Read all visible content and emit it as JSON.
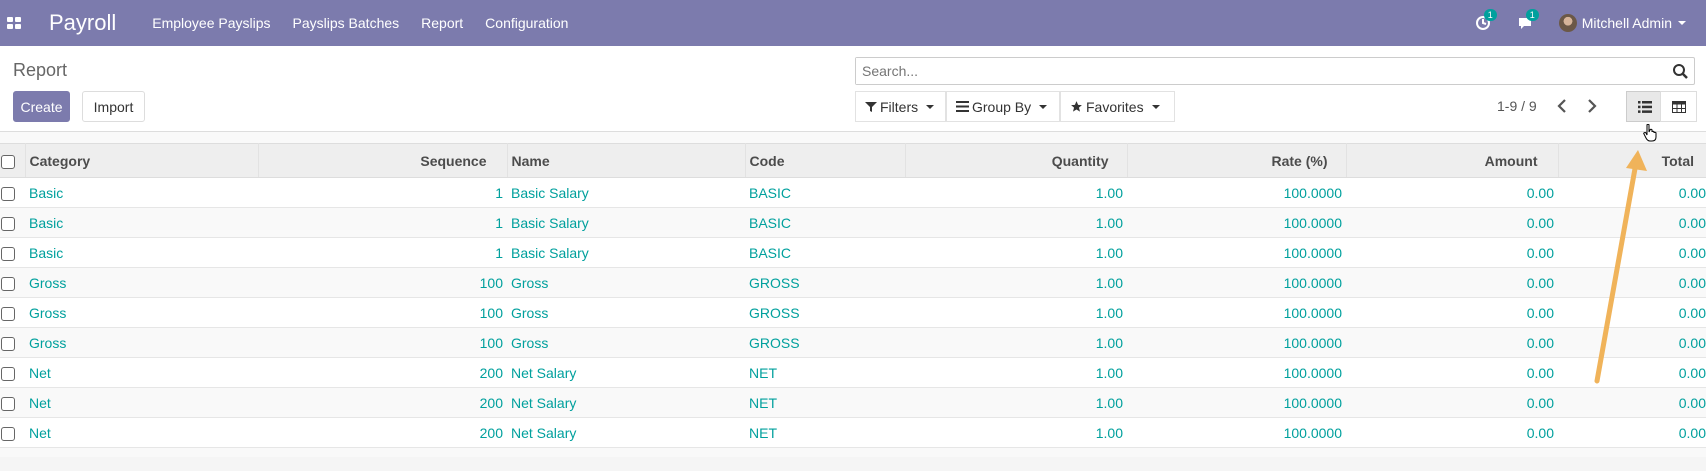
{
  "navbar": {
    "app_name": "Payroll",
    "menu": [
      "Employee Payslips",
      "Payslips Batches",
      "Report",
      "Configuration"
    ],
    "activity_badge": "1",
    "messages_badge": "1",
    "user_name": "Mitchell Admin",
    "bg_color": "#7c7bad"
  },
  "control_panel": {
    "breadcrumb": "Report",
    "create_label": "Create",
    "import_label": "Import",
    "search_placeholder": "Search...",
    "filters_label": "Filters",
    "groupby_label": "Group By",
    "favorites_label": "Favorites",
    "pager": "1-9 / 9"
  },
  "table": {
    "headers": [
      "Category",
      "Sequence",
      "Name",
      "Code",
      "Quantity",
      "Rate (%)",
      "Amount",
      "Total"
    ],
    "rows": [
      [
        "Basic",
        "1",
        "Basic Salary",
        "BASIC",
        "1.00",
        "100.0000",
        "0.00",
        "0.00"
      ],
      [
        "Basic",
        "1",
        "Basic Salary",
        "BASIC",
        "1.00",
        "100.0000",
        "0.00",
        "0.00"
      ],
      [
        "Basic",
        "1",
        "Basic Salary",
        "BASIC",
        "1.00",
        "100.0000",
        "0.00",
        "0.00"
      ],
      [
        "Gross",
        "100",
        "Gross",
        "GROSS",
        "1.00",
        "100.0000",
        "0.00",
        "0.00"
      ],
      [
        "Gross",
        "100",
        "Gross",
        "GROSS",
        "1.00",
        "100.0000",
        "0.00",
        "0.00"
      ],
      [
        "Gross",
        "100",
        "Gross",
        "GROSS",
        "1.00",
        "100.0000",
        "0.00",
        "0.00"
      ],
      [
        "Net",
        "200",
        "Net Salary",
        "NET",
        "1.00",
        "100.0000",
        "0.00",
        "0.00"
      ],
      [
        "Net",
        "200",
        "Net Salary",
        "NET",
        "1.00",
        "100.0000",
        "0.00",
        "0.00"
      ],
      [
        "Net",
        "200",
        "Net Salary",
        "NET",
        "1.00",
        "100.0000",
        "0.00",
        "0.00"
      ]
    ]
  },
  "icons": {
    "apps": "apps-grid-icon",
    "activity": "clock-icon",
    "messages": "chat-bubble-icon",
    "search": "search-icon",
    "filter": "filter-funnel-icon",
    "groupby": "bars-icon",
    "favorites": "star-icon",
    "list_view": "list-view-icon",
    "pivot_view": "table-grid-icon"
  },
  "annotation": {
    "arrow_color": "#f0b35a"
  }
}
